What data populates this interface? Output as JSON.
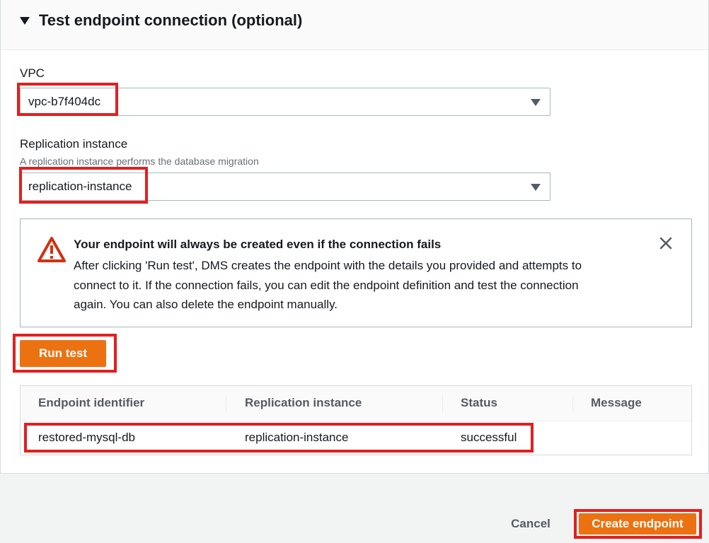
{
  "section": {
    "title": "Test endpoint connection (optional)"
  },
  "vpc": {
    "label": "VPC",
    "value": "vpc-b7f404dc"
  },
  "replication": {
    "label": "Replication instance",
    "description": "A replication instance performs the database migration",
    "value": "replication-instance"
  },
  "alert": {
    "title": "Your endpoint will always be created even if the connection fails",
    "lines": [
      "After clicking 'Run test', DMS creates the endpoint with the details you provided and attempts to",
      "connect to it. If the connection fails, you can edit the endpoint definition and test the connection",
      "again. You can also delete the endpoint manually."
    ]
  },
  "run_test_label": "Run test",
  "table": {
    "headers": [
      "Endpoint identifier",
      "Replication instance",
      "Status",
      "Message"
    ],
    "rows": [
      [
        "restored-mysql-db",
        "replication-instance",
        "successful",
        ""
      ]
    ]
  },
  "footer": {
    "cancel_label": "Cancel",
    "create_label": "Create endpoint"
  },
  "colors": {
    "accent": "#ec7211",
    "highlight": "#e0201f",
    "warning": "#d13212"
  }
}
